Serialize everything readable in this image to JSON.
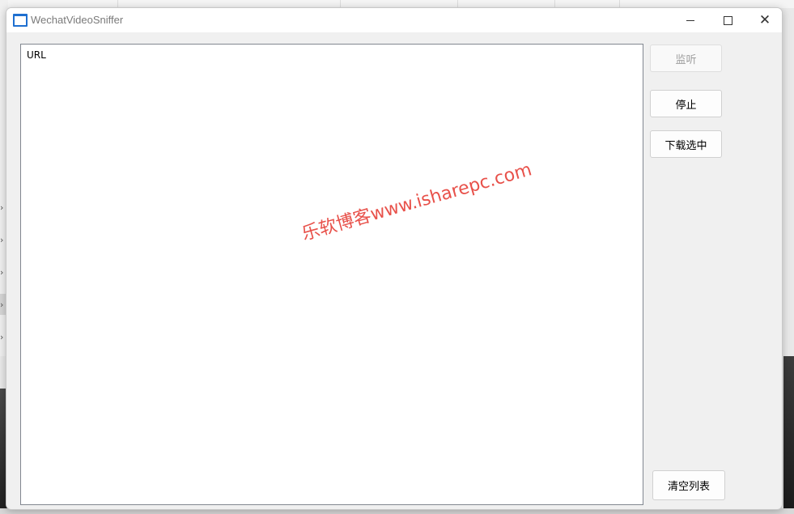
{
  "window": {
    "title": "WechatVideoSniffer",
    "controls": {
      "minimize_icon": "minimize-icon",
      "maximize_icon": "maximize-icon",
      "close_icon": "close-icon",
      "close_glyph": "✕"
    }
  },
  "url_list": {
    "column_header": "URL",
    "items": []
  },
  "buttons": {
    "listen_label": "监听",
    "stop_label": "停止",
    "download_selected_label": "下载选中",
    "clear_list_label": "清空列表"
  },
  "watermark": {
    "text": "乐软博客www.isharepc.com",
    "color": "#e8514a"
  },
  "colors": {
    "accent_icon": "#1e6fd0",
    "disabled_text": "#9d9d9d"
  }
}
